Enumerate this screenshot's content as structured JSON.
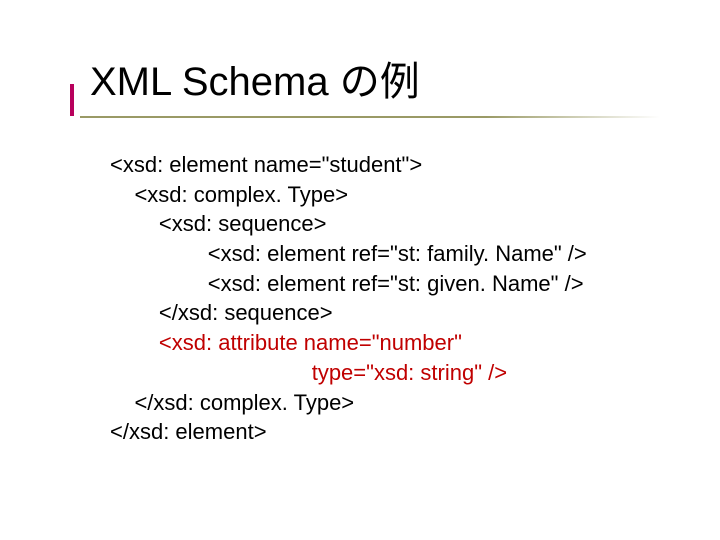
{
  "title": "XML Schema の例",
  "code": {
    "l0": "<xsd: element name=\"student\">",
    "l1": "    <xsd: complex. Type>",
    "l2": "        <xsd: sequence>",
    "l3": "                <xsd: element ref=\"st: family. Name\" />",
    "l4": "                <xsd: element ref=\"st: given. Name\" />",
    "l5": "        </xsd: sequence>",
    "l6a": "        <xsd: attribute name=\"number\"",
    "l6b": "                                 type=\"xsd: string\" />",
    "l7": "    </xsd: complex. Type>",
    "l8": "</xsd: element>"
  }
}
